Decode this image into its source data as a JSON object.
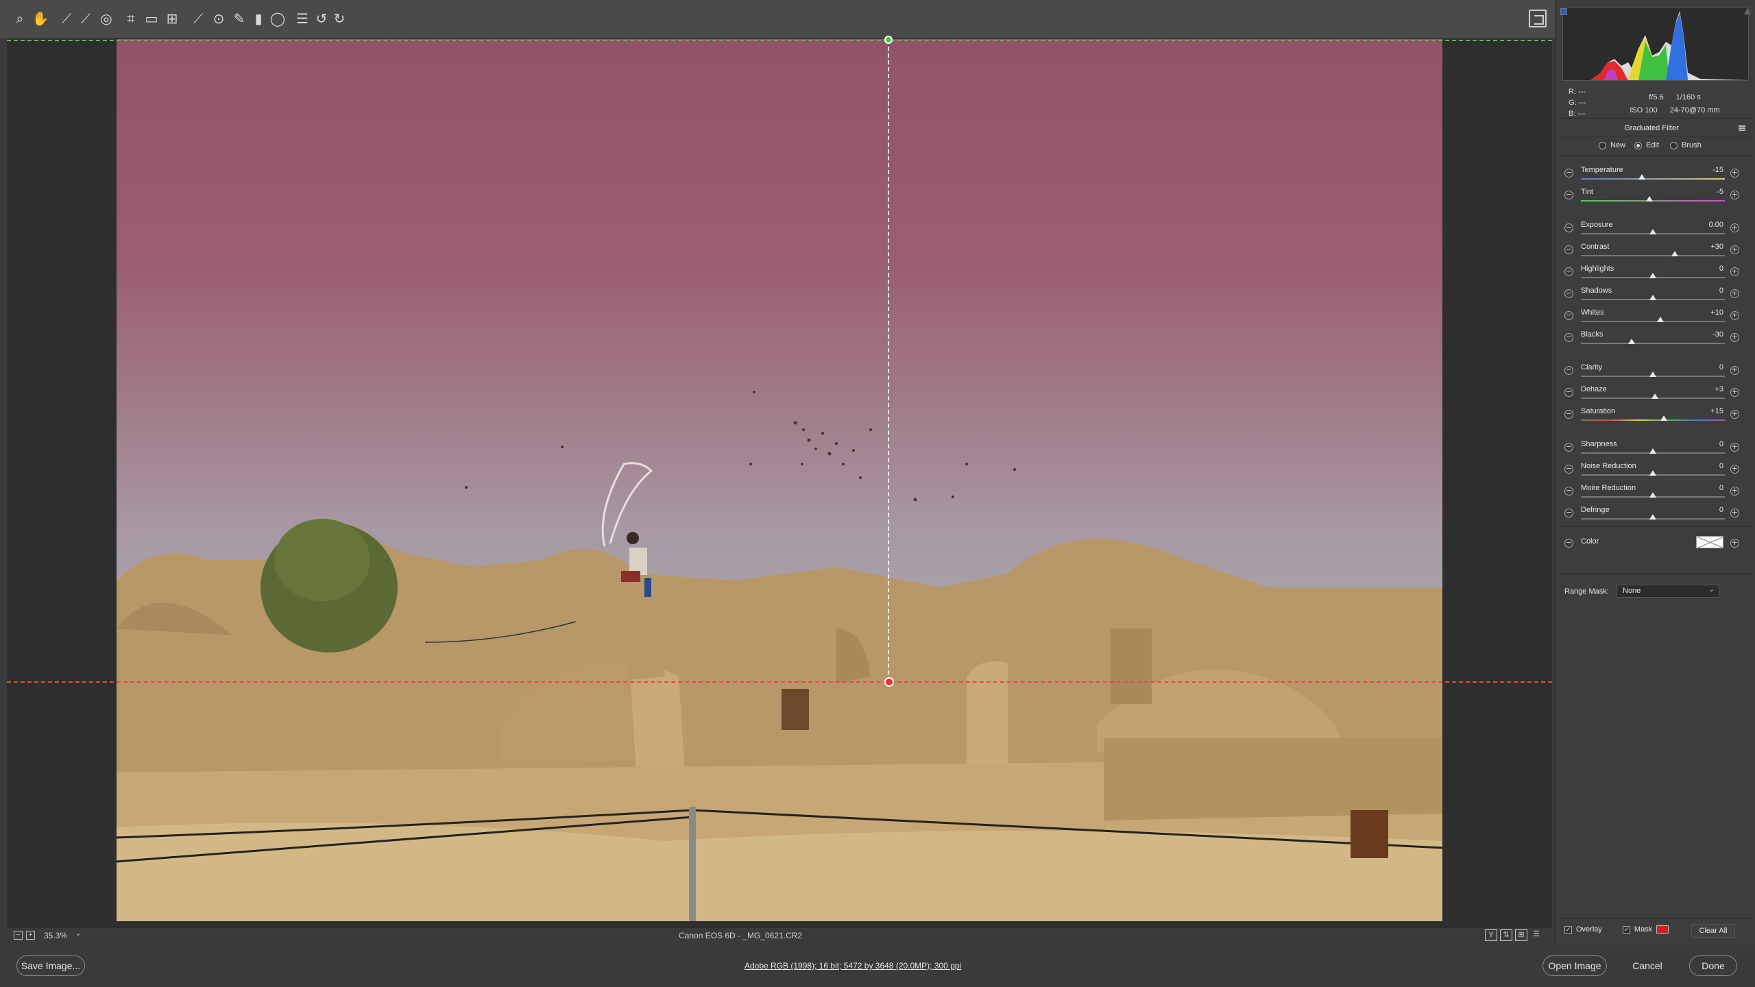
{
  "toolbar": {
    "tools": [
      {
        "name": "zoom-tool-icon",
        "glyph": "⌕"
      },
      {
        "name": "hand-tool-icon",
        "glyph": "✋"
      },
      {
        "name": "white-balance-tool-icon",
        "glyph": "⟋"
      },
      {
        "name": "color-sampler-tool-icon",
        "glyph": "⟋"
      },
      {
        "name": "targeted-adjustment-tool-icon",
        "glyph": "◎"
      },
      {
        "name": "crop-tool-icon",
        "glyph": "⌗"
      },
      {
        "name": "straighten-tool-icon",
        "glyph": "▭"
      },
      {
        "name": "transform-tool-icon",
        "glyph": "⊞"
      },
      {
        "name": "spot-removal-tool-icon",
        "glyph": "⟋"
      },
      {
        "name": "red-eye-removal-tool-icon",
        "glyph": "⊙"
      },
      {
        "name": "adjustment-brush-icon",
        "glyph": "✎"
      },
      {
        "name": "graduated-filter-icon",
        "glyph": "▮"
      },
      {
        "name": "radial-filter-icon",
        "glyph": "◯"
      },
      {
        "name": "presets-list-icon",
        "glyph": "☰"
      },
      {
        "name": "rotate-left-icon",
        "glyph": "↺"
      },
      {
        "name": "rotate-right-icon",
        "glyph": "↻"
      }
    ]
  },
  "status": {
    "zoom": "35.3%",
    "filename": "Canon EOS 6D  -  _MG_0621.CR2"
  },
  "footer": {
    "save_image": "Save Image...",
    "info": "Adobe RGB (1998); 16 bit; 5472 by 3648 (20.0MP); 300 ppi",
    "open_image": "Open Image",
    "cancel": "Cancel",
    "done": "Done"
  },
  "panel": {
    "rgb": {
      "r": "R:   ---",
      "g": "G:   ---",
      "b": "B:   ---"
    },
    "exif": {
      "aperture": "f/5.6",
      "shutter": "1/160 s",
      "iso": "ISO 100",
      "lens": "24-70@70 mm"
    },
    "title": "Graduated Filter",
    "modes": [
      "New",
      "Edit",
      "Brush"
    ],
    "selected_mode": "Edit",
    "sliders": [
      {
        "id": "temperature",
        "label": "Temperature",
        "value": "-15",
        "pos": 0.425,
        "track": "temp"
      },
      {
        "id": "tint",
        "label": "Tint",
        "value": "-5",
        "pos": 0.475,
        "track": "tint"
      },
      {
        "id": "exposure",
        "label": "Exposure",
        "value": "0.00",
        "pos": 0.5,
        "track": ""
      },
      {
        "id": "contrast",
        "label": "Contrast",
        "value": "+30",
        "pos": 0.65,
        "track": ""
      },
      {
        "id": "highlights",
        "label": "Highlights",
        "value": "0",
        "pos": 0.5,
        "track": ""
      },
      {
        "id": "shadows",
        "label": "Shadows",
        "value": "0",
        "pos": 0.5,
        "track": ""
      },
      {
        "id": "whites",
        "label": "Whites",
        "value": "+10",
        "pos": 0.55,
        "track": ""
      },
      {
        "id": "blacks",
        "label": "Blacks",
        "value": "-30",
        "pos": 0.35,
        "track": ""
      },
      {
        "id": "clarity",
        "label": "Clarity",
        "value": "0",
        "pos": 0.5,
        "track": ""
      },
      {
        "id": "dehaze",
        "label": "Dehaze",
        "value": "+3",
        "pos": 0.515,
        "track": ""
      },
      {
        "id": "saturation",
        "label": "Saturation",
        "value": "+15",
        "pos": 0.575,
        "track": "sat"
      },
      {
        "id": "sharpness",
        "label": "Sharpness",
        "value": "0",
        "pos": 0.5,
        "track": ""
      },
      {
        "id": "noise-reduction",
        "label": "Noise Reduction",
        "value": "0",
        "pos": 0.5,
        "track": ""
      },
      {
        "id": "moire-reduction",
        "label": "Moire Reduction",
        "value": "0",
        "pos": 0.5,
        "track": ""
      },
      {
        "id": "defringe",
        "label": "Defringe",
        "value": "0",
        "pos": 0.5,
        "track": ""
      }
    ],
    "color_label": "Color",
    "range_mask_label": "Range Mask:",
    "range_mask_value": "None",
    "overlay_label": "Overlay",
    "mask_label": "Mask",
    "clear_all": "Clear All",
    "mask_color": "#e31919"
  }
}
